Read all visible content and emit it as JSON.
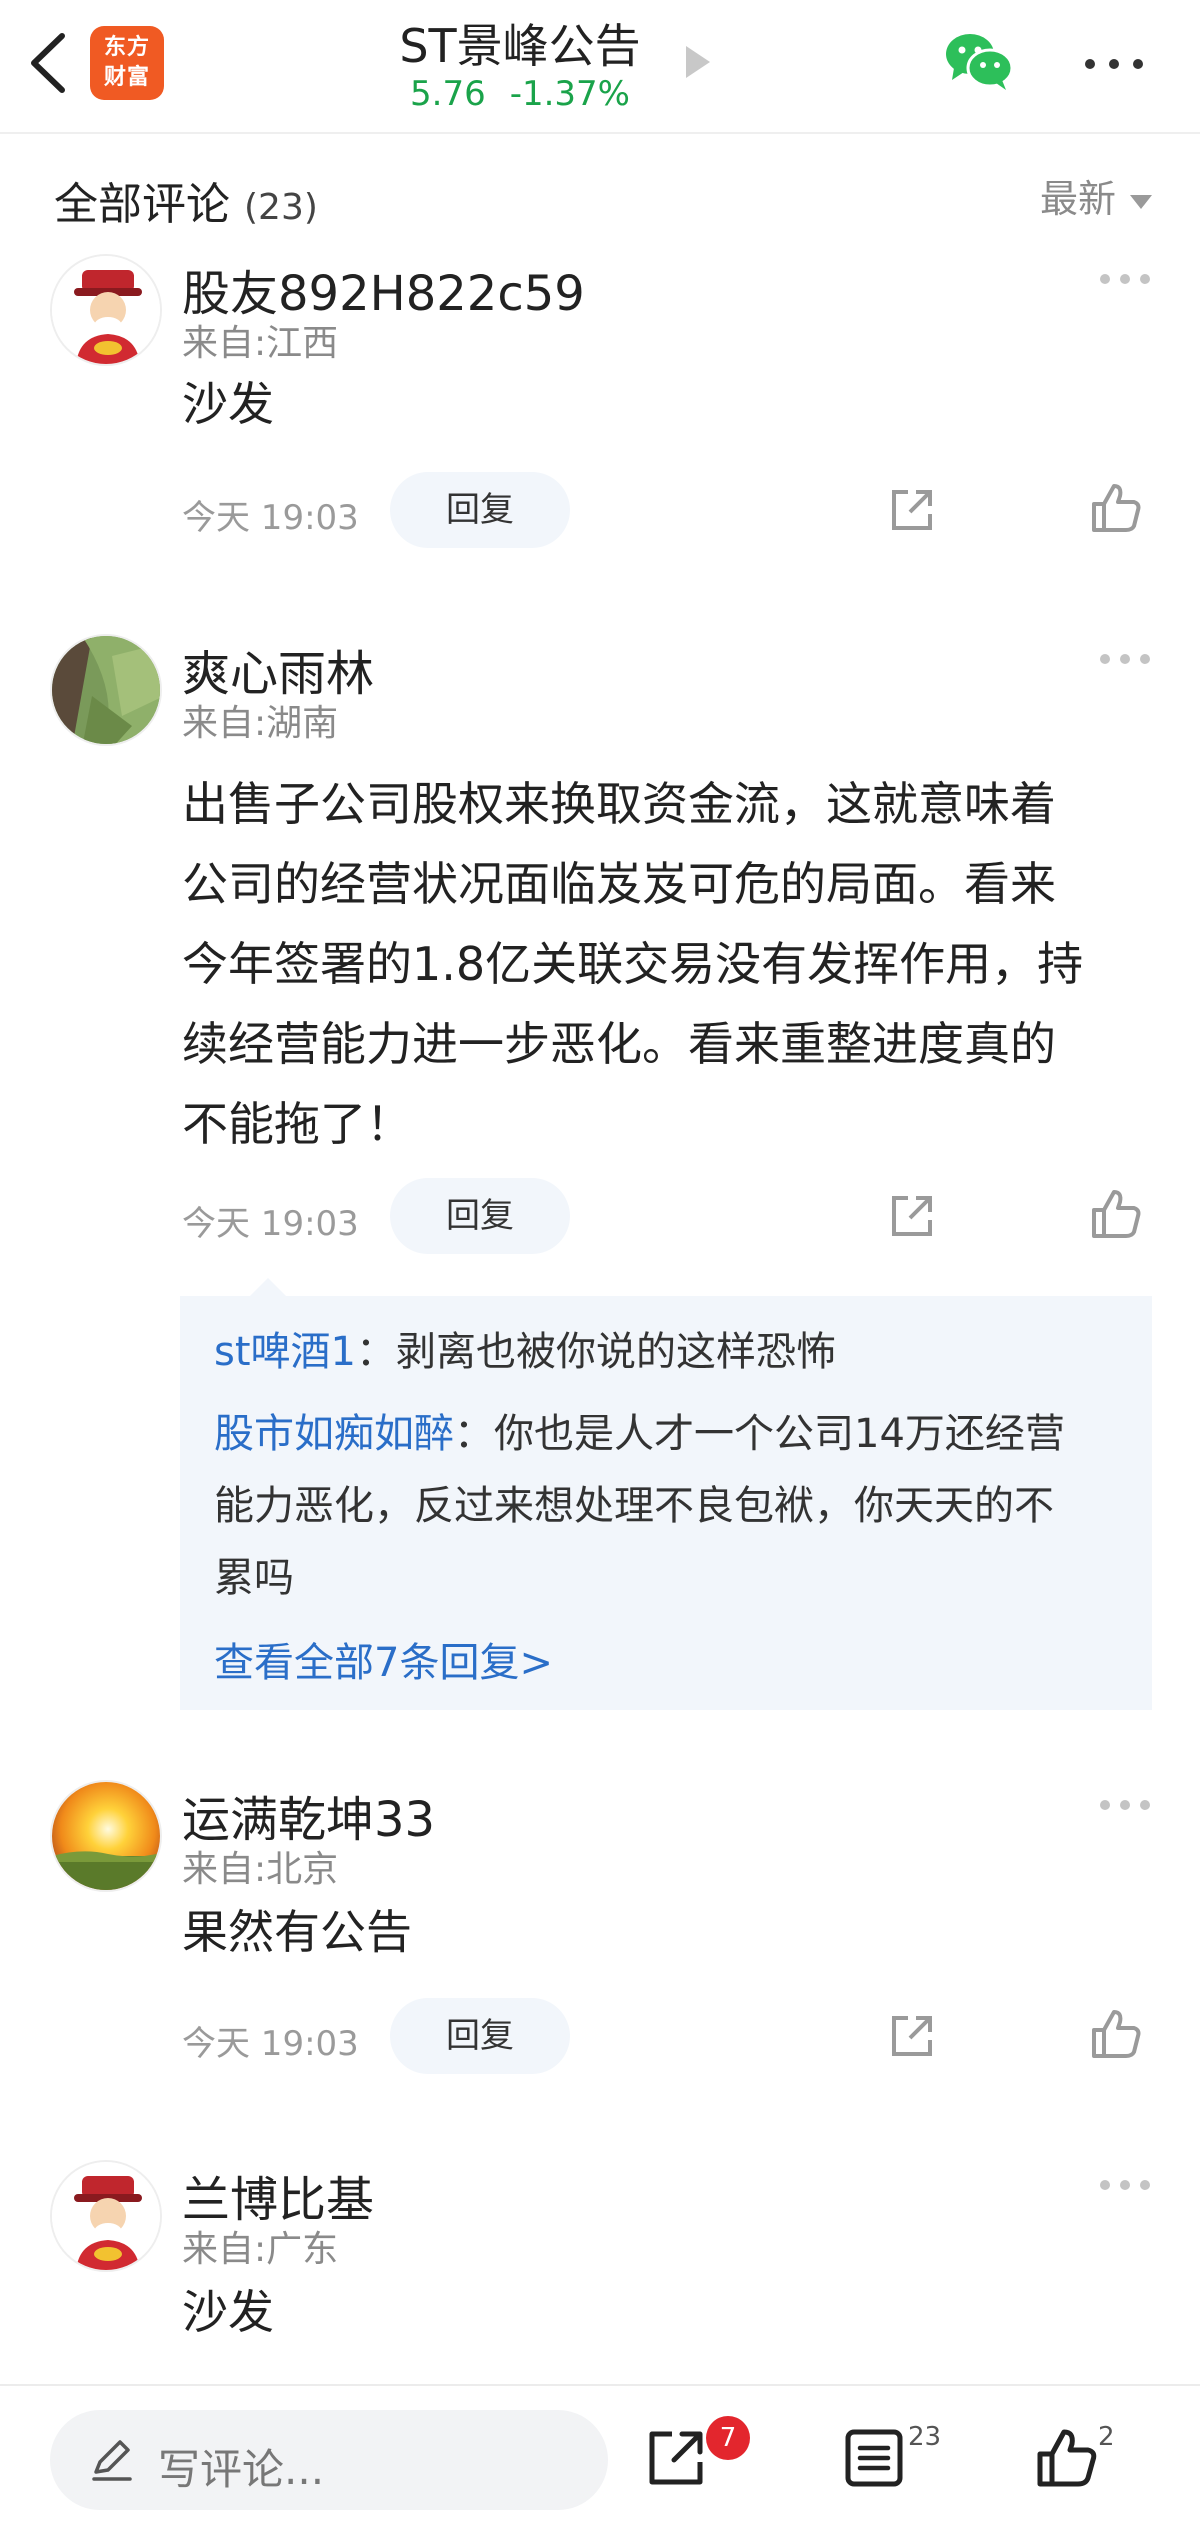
{
  "header": {
    "logo_line1": "东方",
    "logo_line2": "财富",
    "title": "ST景峰公告",
    "price": "5.76",
    "change": "-1.37%"
  },
  "section": {
    "title": "全部评论",
    "count": "(23)",
    "sort_label": "最新"
  },
  "comments": [
    {
      "username": "股友892H822c59",
      "origin": "来自:江西",
      "content": "沙发",
      "time": "今天 19:03",
      "reply_label": "回复"
    },
    {
      "username": "爽心雨林",
      "origin": "来自:湖南",
      "content_lines": [
        "出售子公司股权来换取资金流，这就意味着",
        "公司的经营状况面临岌岌可危的局面。看来",
        "今年签署的1.8亿关联交易没有发挥作用，持",
        "续经营能力进一步恶化。看来重整进度真的",
        "不能拖了！"
      ],
      "time": "今天 19:03",
      "reply_label": "回复",
      "replies": [
        {
          "user": "st啤酒1",
          "text": "：剥离也被你说的这样恐怖"
        },
        {
          "user": "股市如痴如醉",
          "text_lines": [
            "：你也是人才一个公司14万还经营",
            "能力恶化，反过来想处理不良包袱，你天天的不",
            "累吗"
          ]
        }
      ],
      "view_all": "查看全部7条回复>"
    },
    {
      "username": "运满乾坤33",
      "origin": "来自:北京",
      "content": "果然有公告",
      "time": "今天 19:03",
      "reply_label": "回复"
    },
    {
      "username": "兰博比基",
      "origin": "来自:广东",
      "content": "沙发"
    }
  ],
  "bottom_bar": {
    "write_placeholder": "写评论...",
    "share_badge": "7",
    "comment_count": "23",
    "like_count": "2"
  },
  "colors": {
    "up_down_green": "#1aa34a",
    "link_blue": "#2a6ec8",
    "brand_orange": "#f05a23",
    "badge_red": "#e3262d"
  }
}
